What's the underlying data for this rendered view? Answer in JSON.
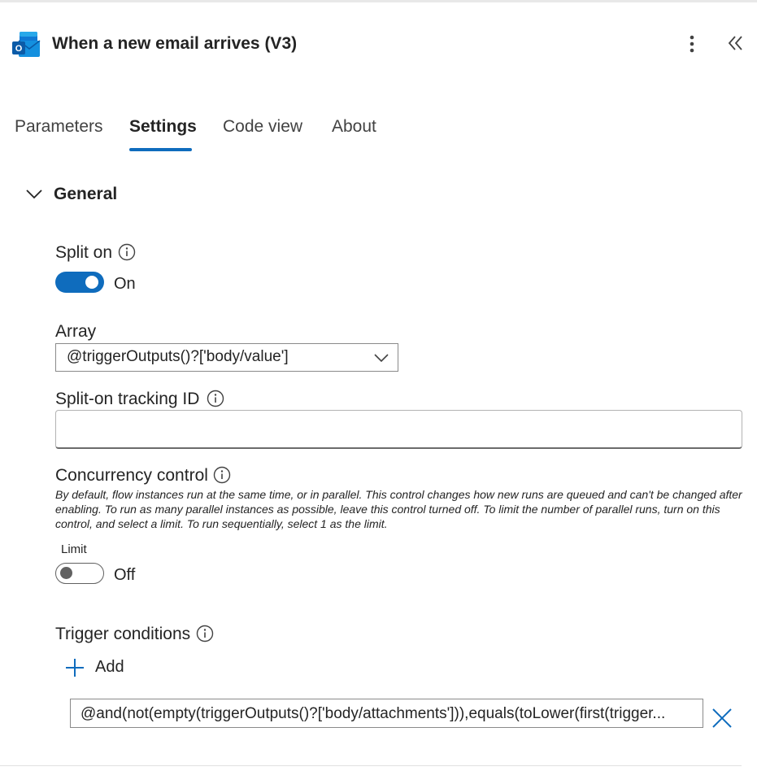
{
  "header": {
    "title": "When a new email arrives (V3)",
    "app_icon": "outlook-icon",
    "more_icon": "more-vertical-icon",
    "collapse_icon": "double-chevron-left-icon"
  },
  "tabs": [
    {
      "label": "Parameters",
      "active": false
    },
    {
      "label": "Settings",
      "active": true
    },
    {
      "label": "Code view",
      "active": false
    },
    {
      "label": "About",
      "active": false
    }
  ],
  "colors": {
    "accent": "#0f6cbd",
    "text": "#242424",
    "delete_icon": "#0f6cbd"
  },
  "section": {
    "title": "General",
    "expanded": true
  },
  "split_on": {
    "label": "Split on",
    "state_text": "On",
    "enabled": true
  },
  "array": {
    "label": "Array",
    "value": "@triggerOutputs()?['body/value']"
  },
  "tracking_id": {
    "label": "Split-on tracking ID",
    "value": ""
  },
  "concurrency": {
    "label": "Concurrency control",
    "description": "By default, flow instances run at the same time, or in parallel. This control changes how new runs are queued and can't be changed after enabling. To run as many parallel instances as possible, leave this control turned off. To limit the number of parallel runs, turn on this control, and select a limit. To run sequentially, select 1 as the limit.",
    "limit_label": "Limit",
    "state_text": "Off",
    "enabled": false
  },
  "trigger_conditions": {
    "label": "Trigger conditions",
    "add_label": "Add",
    "items": [
      {
        "value": "@and(not(empty(triggerOutputs()?['body/attachments'])),equals(toLower(first(trigger..."
      }
    ]
  }
}
